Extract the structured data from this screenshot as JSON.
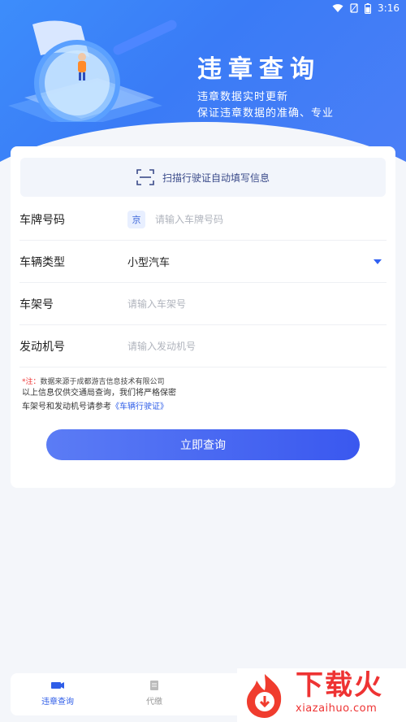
{
  "status_bar": {
    "time": "3:16"
  },
  "hero": {
    "title": "违章查询",
    "subtitle_1": "违章数据实时更新",
    "subtitle_2": "保证违章数据的准确、专业"
  },
  "form": {
    "scan_label": "扫描行驶证自动填写信息",
    "plate": {
      "label": "车牌号码",
      "prefix": "京",
      "placeholder": "请输入车牌号码"
    },
    "vehicle_type": {
      "label": "车辆类型",
      "value": "小型汽车"
    },
    "frame": {
      "label": "车架号",
      "placeholder": "请输入车架号"
    },
    "engine": {
      "label": "发动机号",
      "placeholder": "请输入发动机号"
    },
    "note_star": "*注：",
    "note_source": "数据来源于成都游吉信息技术有限公司",
    "note_privacy": "以上信息仅供交通局查询，我们将严格保密",
    "note_ref": "车架号和发动机号请参考",
    "note_link": "《车辆行驶证》",
    "submit_label": "立即查询"
  },
  "bottom_nav": {
    "items": [
      {
        "label": "违章查询"
      },
      {
        "label": "代缴"
      }
    ]
  },
  "watermark": {
    "big": "下载火",
    "small": "xiazaihuo.com"
  },
  "colors": {
    "accent": "#3a58ef",
    "header": "#3d8dfb",
    "brand_red": "#e33333"
  }
}
